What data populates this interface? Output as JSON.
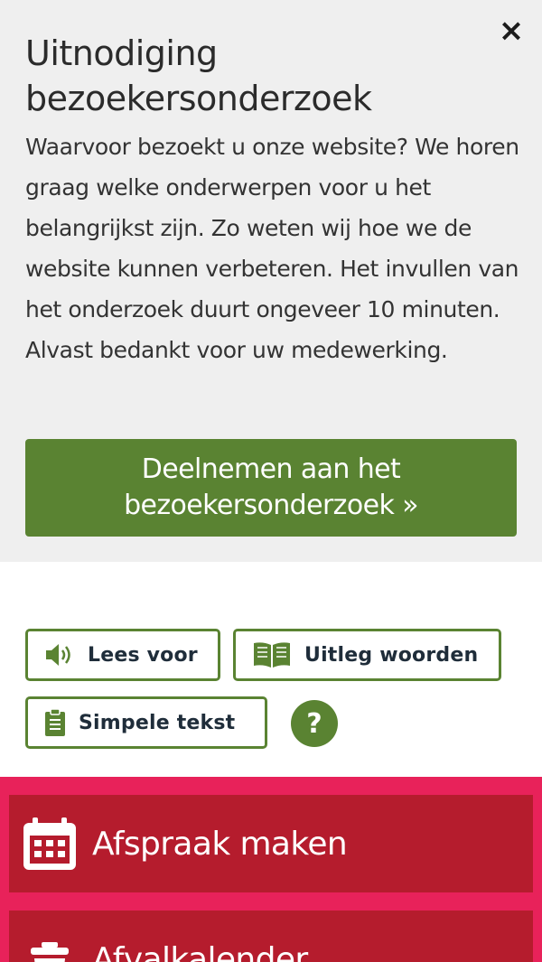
{
  "survey": {
    "title": "Uitnodiging bezoekersonderzoek",
    "text": "Waarvoor bezoekt u onze website? We horen graag welke onderwerpen voor u het belangrijkst zijn. Zo weten wij hoe we de website kunnen verbeteren. Het invullen van het onderzoek duurt ongeveer 10 minuten. Alvast bedankt voor uw medewerking.",
    "button_label": "Deelnemen aan het bezoekersonderzoek »",
    "close_symbol": "×"
  },
  "tools": {
    "read_aloud": "Lees voor",
    "explain_words": "Uitleg woorden",
    "simple_text": "Simpele tekst",
    "help_symbol": "?"
  },
  "tiles": [
    {
      "label": "Afspraak maken",
      "icon": "calendar-icon"
    },
    {
      "label": "Afvalkalender",
      "icon": "trash-bin-icon"
    }
  ],
  "colors": {
    "accent_green": "#5a8332",
    "tile_red": "#b51c2d",
    "tile_border_pink": "#e8225a",
    "panel_grey": "#efefef"
  }
}
